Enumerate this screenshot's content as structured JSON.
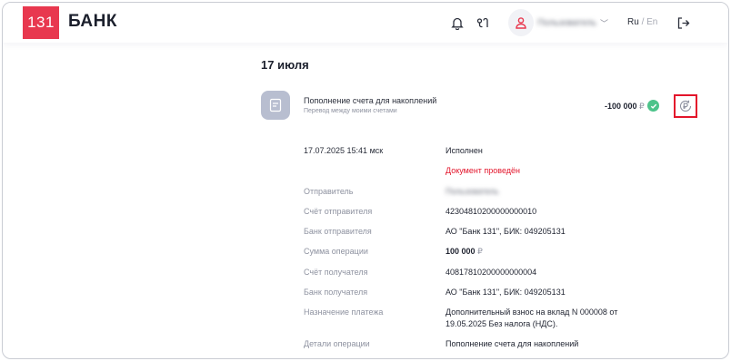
{
  "header": {
    "logo_text": "131",
    "brand": "БАНК",
    "user_name": "Пользователь",
    "lang_ru": "Ru",
    "lang_sep": "/",
    "lang_en": "En"
  },
  "main": {
    "date_title": "17 июля",
    "operation": {
      "title": "Пополнение счета для накоплений",
      "subtitle": "Перевод между моими счетами",
      "amount": "-100 000",
      "currency": "₽",
      "status_color": "#4cc38a"
    },
    "details": {
      "datetime": "17.07.2025 15:41 мск",
      "status": "Исполнен",
      "document_status": "Документ проведён",
      "rows": [
        {
          "label": "Отправитель",
          "value": "Пользователь"
        },
        {
          "label": "Счёт отправителя",
          "value": "42304810200000000010"
        },
        {
          "label": "Банк отправителя",
          "value": "АО \"Банк 131\", БИК: 049205131"
        },
        {
          "label": "Сумма операции",
          "value": "100 000",
          "currency": "₽"
        },
        {
          "label": "Счёт получателя",
          "value": "40817810200000000004"
        },
        {
          "label": "Банк получателя",
          "value": "АО \"Банк 131\", БИК: 049205131"
        },
        {
          "label": "Назначение платежа",
          "value": "Дополнительный взнос на вклад N 000008 от 19.05.2025 Без налога (НДС)."
        },
        {
          "label": "Детали операции",
          "value": "Пополнение счета для накоплений"
        }
      ]
    }
  },
  "colors": {
    "brand_red": "#e8384f",
    "highlight_red": "#e3152b",
    "success_green": "#4cc38a"
  }
}
